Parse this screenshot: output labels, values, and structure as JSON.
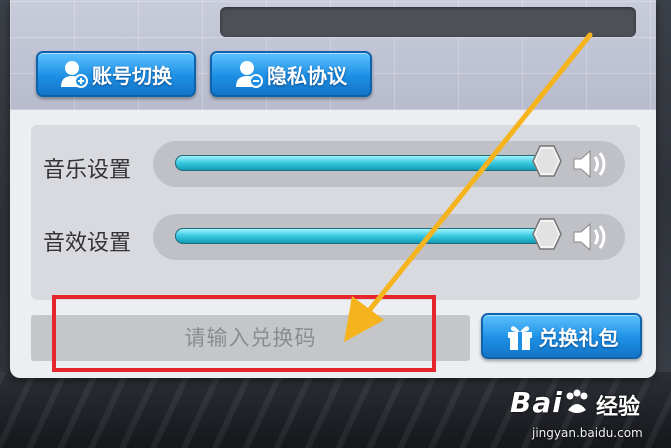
{
  "header": {
    "switch_account_label": "账号切换",
    "privacy_label": "隐私协议"
  },
  "settings": {
    "music": {
      "label": "音乐设置",
      "level": 0.98
    },
    "effect": {
      "label": "音效设置",
      "level": 0.98
    }
  },
  "redeem": {
    "placeholder": "请输入兑换码",
    "button_label": "兑换礼包"
  },
  "watermark": {
    "brand": "Bai",
    "brand_cn": "经验",
    "url": "jingyan.baidu.com"
  },
  "colors": {
    "button_blue": "#1d8fe4",
    "slider_cyan": "#38c8e0",
    "annotation_red": "#e6262a",
    "annotation_arrow": "#f5b31e"
  },
  "icons": {
    "switch_account": "user-switch-icon",
    "privacy": "user-privacy-icon",
    "gift": "gift-icon",
    "music_speaker": "speaker-icon",
    "effect_speaker": "speaker-icon",
    "slider_knob": "slider-knob"
  }
}
